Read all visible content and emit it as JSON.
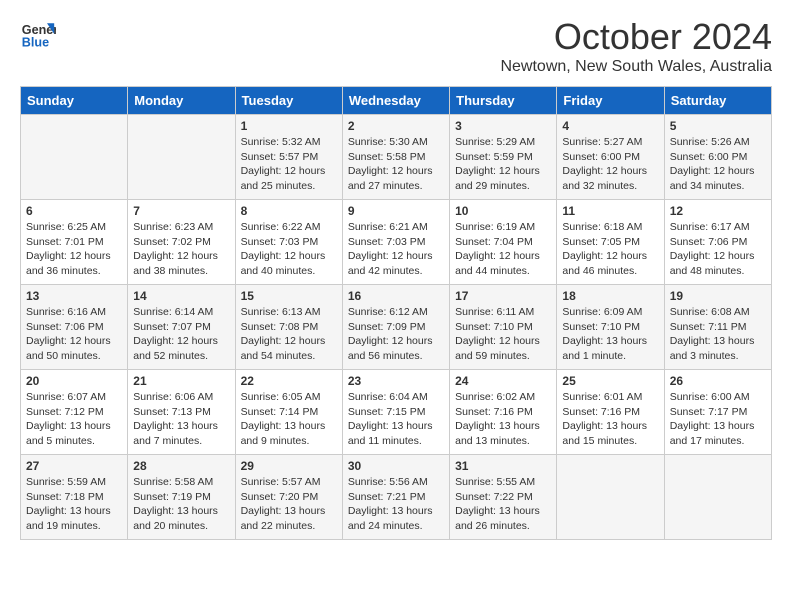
{
  "header": {
    "logo_line1": "General",
    "logo_line2": "Blue",
    "month": "October 2024",
    "location": "Newtown, New South Wales, Australia"
  },
  "days_of_week": [
    "Sunday",
    "Monday",
    "Tuesday",
    "Wednesday",
    "Thursday",
    "Friday",
    "Saturday"
  ],
  "weeks": [
    [
      {
        "day": "",
        "content": ""
      },
      {
        "day": "",
        "content": ""
      },
      {
        "day": "1",
        "content": "Sunrise: 5:32 AM\nSunset: 5:57 PM\nDaylight: 12 hours\nand 25 minutes."
      },
      {
        "day": "2",
        "content": "Sunrise: 5:30 AM\nSunset: 5:58 PM\nDaylight: 12 hours\nand 27 minutes."
      },
      {
        "day": "3",
        "content": "Sunrise: 5:29 AM\nSunset: 5:59 PM\nDaylight: 12 hours\nand 29 minutes."
      },
      {
        "day": "4",
        "content": "Sunrise: 5:27 AM\nSunset: 6:00 PM\nDaylight: 12 hours\nand 32 minutes."
      },
      {
        "day": "5",
        "content": "Sunrise: 5:26 AM\nSunset: 6:00 PM\nDaylight: 12 hours\nand 34 minutes."
      }
    ],
    [
      {
        "day": "6",
        "content": "Sunrise: 6:25 AM\nSunset: 7:01 PM\nDaylight: 12 hours\nand 36 minutes."
      },
      {
        "day": "7",
        "content": "Sunrise: 6:23 AM\nSunset: 7:02 PM\nDaylight: 12 hours\nand 38 minutes."
      },
      {
        "day": "8",
        "content": "Sunrise: 6:22 AM\nSunset: 7:03 PM\nDaylight: 12 hours\nand 40 minutes."
      },
      {
        "day": "9",
        "content": "Sunrise: 6:21 AM\nSunset: 7:03 PM\nDaylight: 12 hours\nand 42 minutes."
      },
      {
        "day": "10",
        "content": "Sunrise: 6:19 AM\nSunset: 7:04 PM\nDaylight: 12 hours\nand 44 minutes."
      },
      {
        "day": "11",
        "content": "Sunrise: 6:18 AM\nSunset: 7:05 PM\nDaylight: 12 hours\nand 46 minutes."
      },
      {
        "day": "12",
        "content": "Sunrise: 6:17 AM\nSunset: 7:06 PM\nDaylight: 12 hours\nand 48 minutes."
      }
    ],
    [
      {
        "day": "13",
        "content": "Sunrise: 6:16 AM\nSunset: 7:06 PM\nDaylight: 12 hours\nand 50 minutes."
      },
      {
        "day": "14",
        "content": "Sunrise: 6:14 AM\nSunset: 7:07 PM\nDaylight: 12 hours\nand 52 minutes."
      },
      {
        "day": "15",
        "content": "Sunrise: 6:13 AM\nSunset: 7:08 PM\nDaylight: 12 hours\nand 54 minutes."
      },
      {
        "day": "16",
        "content": "Sunrise: 6:12 AM\nSunset: 7:09 PM\nDaylight: 12 hours\nand 56 minutes."
      },
      {
        "day": "17",
        "content": "Sunrise: 6:11 AM\nSunset: 7:10 PM\nDaylight: 12 hours\nand 59 minutes."
      },
      {
        "day": "18",
        "content": "Sunrise: 6:09 AM\nSunset: 7:10 PM\nDaylight: 13 hours\nand 1 minute."
      },
      {
        "day": "19",
        "content": "Sunrise: 6:08 AM\nSunset: 7:11 PM\nDaylight: 13 hours\nand 3 minutes."
      }
    ],
    [
      {
        "day": "20",
        "content": "Sunrise: 6:07 AM\nSunset: 7:12 PM\nDaylight: 13 hours\nand 5 minutes."
      },
      {
        "day": "21",
        "content": "Sunrise: 6:06 AM\nSunset: 7:13 PM\nDaylight: 13 hours\nand 7 minutes."
      },
      {
        "day": "22",
        "content": "Sunrise: 6:05 AM\nSunset: 7:14 PM\nDaylight: 13 hours\nand 9 minutes."
      },
      {
        "day": "23",
        "content": "Sunrise: 6:04 AM\nSunset: 7:15 PM\nDaylight: 13 hours\nand 11 minutes."
      },
      {
        "day": "24",
        "content": "Sunrise: 6:02 AM\nSunset: 7:16 PM\nDaylight: 13 hours\nand 13 minutes."
      },
      {
        "day": "25",
        "content": "Sunrise: 6:01 AM\nSunset: 7:16 PM\nDaylight: 13 hours\nand 15 minutes."
      },
      {
        "day": "26",
        "content": "Sunrise: 6:00 AM\nSunset: 7:17 PM\nDaylight: 13 hours\nand 17 minutes."
      }
    ],
    [
      {
        "day": "27",
        "content": "Sunrise: 5:59 AM\nSunset: 7:18 PM\nDaylight: 13 hours\nand 19 minutes."
      },
      {
        "day": "28",
        "content": "Sunrise: 5:58 AM\nSunset: 7:19 PM\nDaylight: 13 hours\nand 20 minutes."
      },
      {
        "day": "29",
        "content": "Sunrise: 5:57 AM\nSunset: 7:20 PM\nDaylight: 13 hours\nand 22 minutes."
      },
      {
        "day": "30",
        "content": "Sunrise: 5:56 AM\nSunset: 7:21 PM\nDaylight: 13 hours\nand 24 minutes."
      },
      {
        "day": "31",
        "content": "Sunrise: 5:55 AM\nSunset: 7:22 PM\nDaylight: 13 hours\nand 26 minutes."
      },
      {
        "day": "",
        "content": ""
      },
      {
        "day": "",
        "content": ""
      }
    ]
  ]
}
